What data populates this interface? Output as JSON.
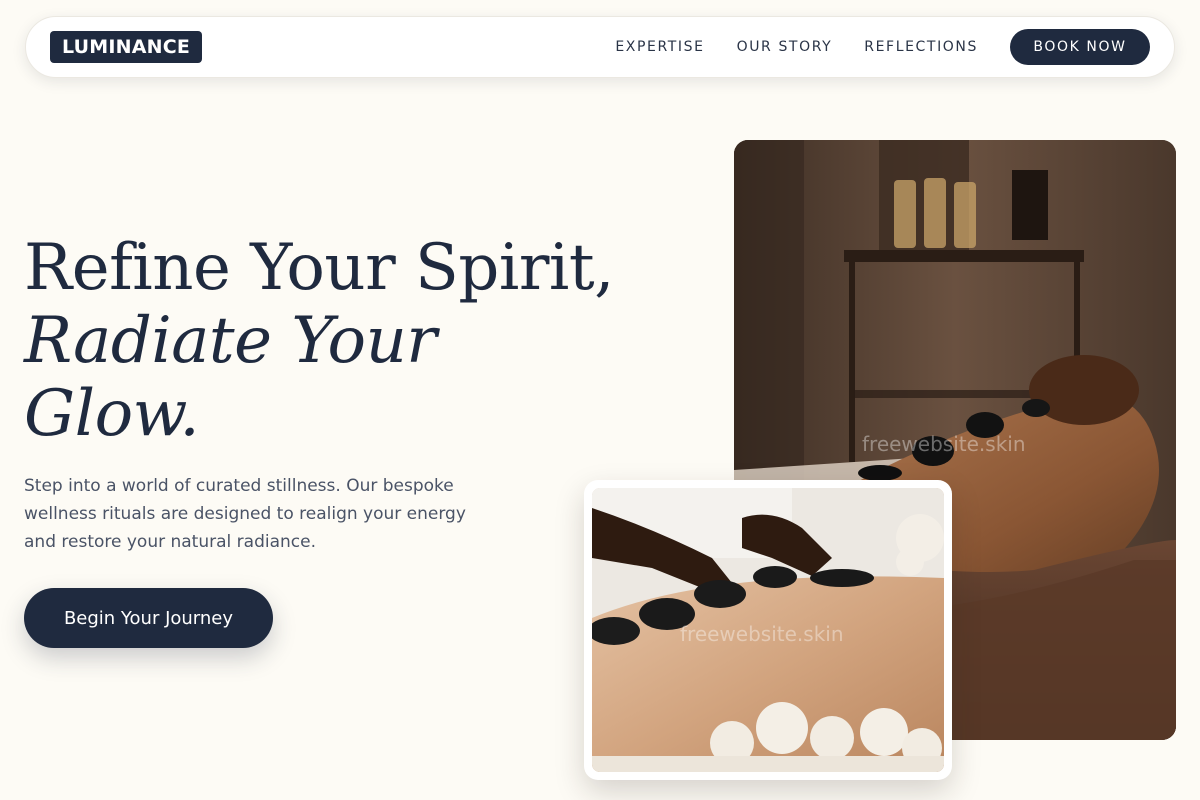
{
  "nav": {
    "logo": "LUMINANCE",
    "links": [
      "EXPERTISE",
      "OUR STORY",
      "REFLECTIONS"
    ],
    "book_label": "BOOK NOW"
  },
  "hero": {
    "headline_line1": "Refine Your Spirit,",
    "headline_italic": "Radiate Your Glow.",
    "description": "Step into a world of curated stillness. Our bespoke wellness rituals are designed to realign your energy and restore your natural radiance.",
    "cta_label": "Begin Your Journey"
  },
  "images": {
    "large_watermark": "freewebsite.skin",
    "small_watermark": "freewebsite.skin"
  },
  "colors": {
    "background": "#fdfbf5",
    "primary": "#1f2a3f",
    "text_muted": "#4a5366"
  }
}
